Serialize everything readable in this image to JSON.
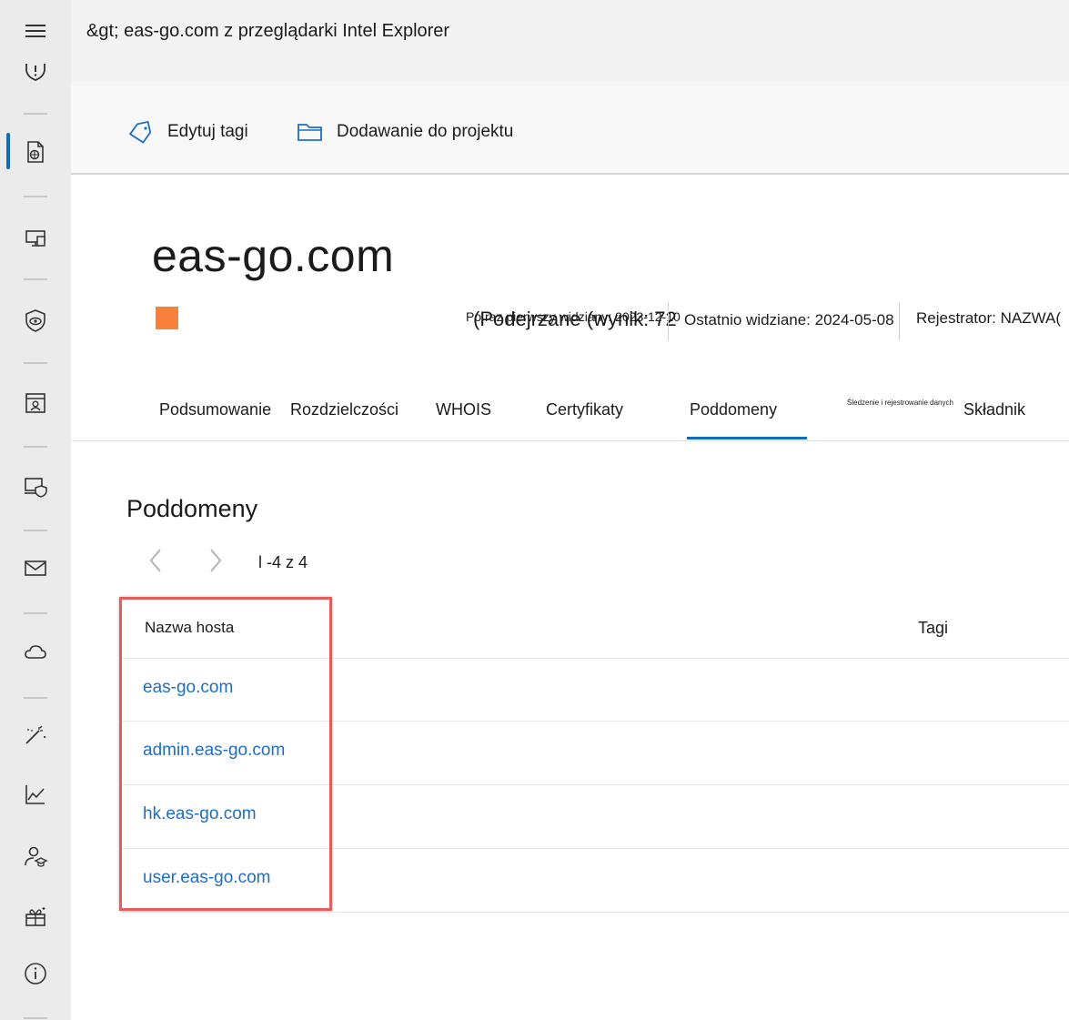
{
  "breadcrumb": "&gt; eas-go.com z przeglądarki Intel Explorer",
  "actions": {
    "edit_tags": "Edytuj tagi",
    "add_to_project": "Dodawanie do projektu"
  },
  "header": {
    "title": "eas-go.com",
    "risk_color": "#f7813a",
    "first_seen": "Po raz pierwszy widziany: 2023-12-10",
    "suspicious": "(Podejrzane (wynik: 72",
    "last_seen": "Ostatnio widziane: 2024-05-08",
    "registrar": "Rejestrator: NAZWA("
  },
  "tabs": [
    "Podsumowanie",
    "Rozdzielczości",
    "WHOIS",
    "Certyfikaty",
    "Poddomeny",
    "Śledzenie i rejestrowanie danych",
    "Składnik"
  ],
  "active_tab": "Poddomeny",
  "section": {
    "title": "Poddomeny",
    "pager_count": "l -4 z 4"
  },
  "table": {
    "columns": [
      "Nazwa hosta",
      "Tagi"
    ],
    "rows": [
      "eas-go.com",
      "admin.eas-go.com",
      "hk.eas-go.com",
      "user.eas-go.com"
    ]
  },
  "rail_icons": [
    "menu-icon",
    "shield-alert-icon",
    "threat-intel-icon",
    "devices-icon",
    "vulnerability-icon",
    "identity-icon",
    "endpoint-shield-icon",
    "mail-icon",
    "cloud-icon",
    "wand-icon",
    "chart-icon",
    "learning-icon",
    "partner-icon",
    "info-icon"
  ],
  "accent_color": "#0f6cbd",
  "link_color": "#1e6fc4"
}
